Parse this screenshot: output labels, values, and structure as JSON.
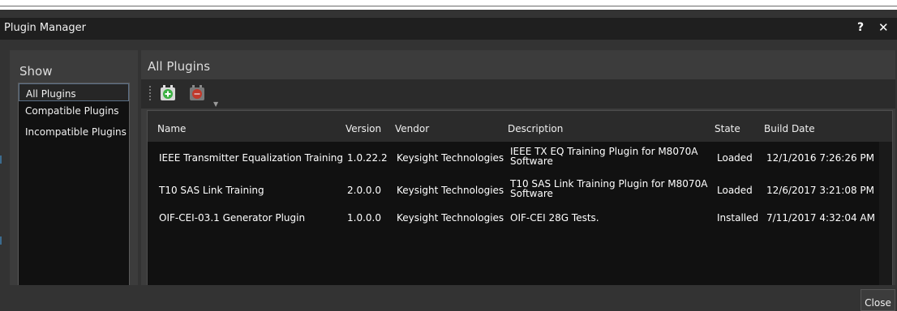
{
  "window": {
    "title": "Plugin Manager",
    "help_glyph": "?",
    "close_glyph": "✕"
  },
  "show_panel": {
    "header": "Show",
    "items": [
      {
        "label": "All Plugins",
        "selected": true
      },
      {
        "label": "Compatible Plugins",
        "selected": false
      },
      {
        "label": "Incompatible Plugins",
        "selected": false
      }
    ]
  },
  "main_panel": {
    "header": "All Plugins",
    "toolbar": {
      "add_icon": "add-plugin-icon",
      "remove_icon": "remove-plugin-icon",
      "add_color": "#3cb043",
      "remove_color": "#c0392b",
      "dropdown_glyph": "▼"
    }
  },
  "table": {
    "columns": [
      "Name",
      "Version",
      "Vendor",
      "Description",
      "State",
      "Build Date"
    ],
    "rows": [
      {
        "name": "IEEE Transmitter Equalization Training",
        "version": "1.0.22.2",
        "vendor": "Keysight Technologies",
        "description": "IEEE TX EQ Training Plugin for M8070A Software",
        "state": "Loaded",
        "build_date": "12/1/2016 7:26:26 PM"
      },
      {
        "name": "T10 SAS Link Training",
        "version": "2.0.0.0",
        "vendor": "Keysight Technologies",
        "description": "T10 SAS Link Training Plugin for M8070A Software",
        "state": "Loaded",
        "build_date": "12/6/2017 3:21:08 PM"
      },
      {
        "name": "OIF-CEI-03.1 Generator Plugin",
        "version": "1.0.0.0",
        "vendor": "Keysight Technologies",
        "description": "OIF-CEI 28G Tests.",
        "state": "Installed",
        "build_date": "7/11/2017 4:32:04 AM"
      }
    ]
  },
  "footer": {
    "close_label": "Close"
  },
  "colors": {
    "background": "#333333",
    "panel": "#3c3c3c",
    "list_bg": "#111111",
    "selection_border": "#5b6f86"
  }
}
